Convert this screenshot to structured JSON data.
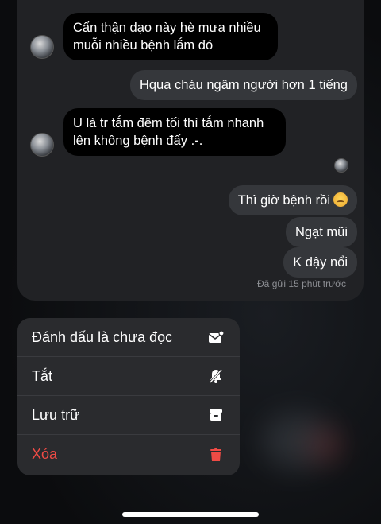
{
  "chat": {
    "messages": [
      {
        "side": "in",
        "text": "Cẩn thận dạo này hè mưa nhiều muỗi nhiều bệnh lắm đó"
      },
      {
        "side": "out",
        "text": "Hqua cháu ngâm người hơn 1 tiếng"
      },
      {
        "side": "in",
        "text": "U là tr tắm đêm tối thì tắm nhanh lên không bệnh đấy .-."
      },
      {
        "side": "out",
        "text": "Thì giờ bệnh rồi"
      },
      {
        "side": "out",
        "text": "Ngạt mũi"
      },
      {
        "side": "out",
        "text": "K dậy nổi"
      }
    ],
    "status": "Đã gửi 15 phút trước"
  },
  "menu": {
    "items": [
      {
        "label": "Đánh dấu là chưa đọc",
        "icon": "mark-unread-icon"
      },
      {
        "label": "Tắt",
        "icon": "mute-bell-icon"
      },
      {
        "label": "Lưu trữ",
        "icon": "archive-icon"
      },
      {
        "label": "Xóa",
        "icon": "trash-icon",
        "color": "#ef4b45"
      }
    ]
  },
  "colors": {
    "menu_bg": "#2a2b2e",
    "card_bg": "#212225",
    "danger": "#ef4b45"
  }
}
